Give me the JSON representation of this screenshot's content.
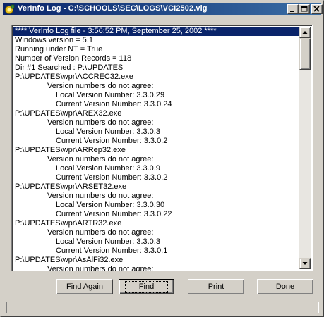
{
  "window": {
    "title": "VerInfo Log - C:\\SCHOOLS\\SEC\\LOGS\\VCI2502.vlg"
  },
  "log": {
    "lines": [
      {
        "text": "**** VerInfo Log file - 3:56:52 PM, September 25, 2002 ****",
        "indent": 0,
        "selected": true
      },
      {
        "text": "Windows version = 5.1",
        "indent": 0
      },
      {
        "text": "Running under NT = True",
        "indent": 0
      },
      {
        "text": "Number of Version Records = 118",
        "indent": 0
      },
      {
        "text": "Dir #1 Searched : P:\\UPDATES",
        "indent": 0
      },
      {
        "text": "P:\\UPDATES\\wpr\\ACCREC32.exe",
        "indent": 0
      },
      {
        "text": "Version numbers do not agree:",
        "indent": 1
      },
      {
        "text": "Local Version Number: 3.3.0.29",
        "indent": 2
      },
      {
        "text": "Current Version Number: 3.3.0.24",
        "indent": 2
      },
      {
        "text": "P:\\UPDATES\\wpr\\AREX32.exe",
        "indent": 0
      },
      {
        "text": "Version numbers do not agree:",
        "indent": 1
      },
      {
        "text": "Local Version Number: 3.3.0.3",
        "indent": 2
      },
      {
        "text": "Current Version Number: 3.3.0.2",
        "indent": 2
      },
      {
        "text": "P:\\UPDATES\\wpr\\ARRep32.exe",
        "indent": 0
      },
      {
        "text": "Version numbers do not agree:",
        "indent": 1
      },
      {
        "text": "Local Version Number: 3.3.0.9",
        "indent": 2
      },
      {
        "text": "Current Version Number: 3.3.0.2",
        "indent": 2
      },
      {
        "text": "P:\\UPDATES\\wpr\\ARSET32.exe",
        "indent": 0
      },
      {
        "text": "Version numbers do not agree:",
        "indent": 1
      },
      {
        "text": "Local Version Number: 3.3.0.30",
        "indent": 2
      },
      {
        "text": "Current Version Number: 3.3.0.22",
        "indent": 2
      },
      {
        "text": "P:\\UPDATES\\wpr\\ARTR32.exe",
        "indent": 0
      },
      {
        "text": "Version numbers do not agree:",
        "indent": 1
      },
      {
        "text": "Local Version Number: 3.3.0.3",
        "indent": 2
      },
      {
        "text": "Current Version Number: 3.3.0.1",
        "indent": 2
      },
      {
        "text": "P:\\UPDATES\\wpr\\AsAlFi32.exe",
        "indent": 0
      },
      {
        "text": "Version numbers do not agree:",
        "indent": 1
      }
    ]
  },
  "buttons": {
    "find_again": "Find Again",
    "find": "Find",
    "print": "Print",
    "done": "Done"
  },
  "colors": {
    "title_bar": "#0a246a",
    "selection": "#0a246a",
    "face": "#d4d0c8"
  }
}
